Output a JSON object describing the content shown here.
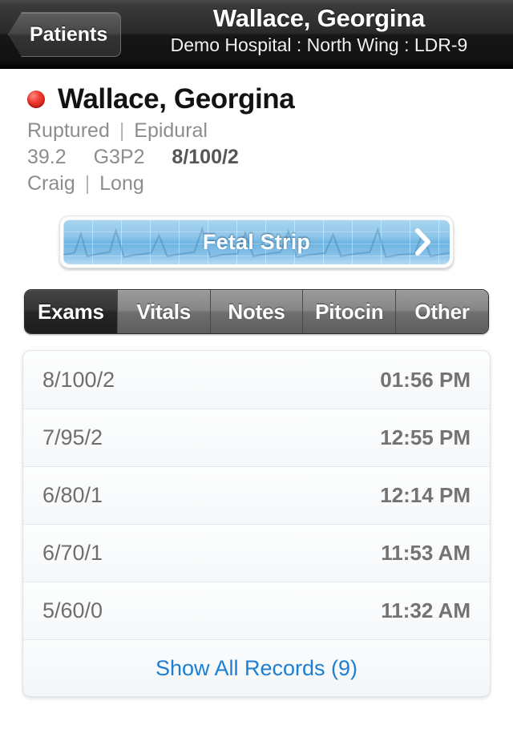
{
  "navbar": {
    "back_label": "Patients",
    "title": "Wallace, Georgina",
    "subtitle": "Demo Hospital : North Wing : LDR-9"
  },
  "patient": {
    "status_color": "#e8352c",
    "name": "Wallace, Georgina",
    "membranes": "Ruptured",
    "anesthesia": "Epidural",
    "gestational_age": "39.2",
    "gravida_para": "G3P2",
    "last_exam": "8/100/2",
    "provider": "Craig",
    "nurse": "Long",
    "separator": "|"
  },
  "fetal_strip": {
    "label": "Fetal Strip",
    "chevron": "chevron-right-icon"
  },
  "tabs": {
    "items": [
      {
        "label": "Exams",
        "active": true
      },
      {
        "label": "Vitals",
        "active": false
      },
      {
        "label": "Notes",
        "active": false
      },
      {
        "label": "Pitocin",
        "active": false
      },
      {
        "label": "Other",
        "active": false
      }
    ]
  },
  "records": {
    "rows": [
      {
        "exam": "8/100/2",
        "time": "01:56 PM"
      },
      {
        "exam": "7/95/2",
        "time": "12:55 PM"
      },
      {
        "exam": "6/80/1",
        "time": "12:14 PM"
      },
      {
        "exam": "6/70/1",
        "time": "11:53 AM"
      },
      {
        "exam": "5/60/0",
        "time": "11:32 AM"
      }
    ],
    "show_all_label": "Show All Records (9)",
    "link_color": "#1c7fd4"
  }
}
